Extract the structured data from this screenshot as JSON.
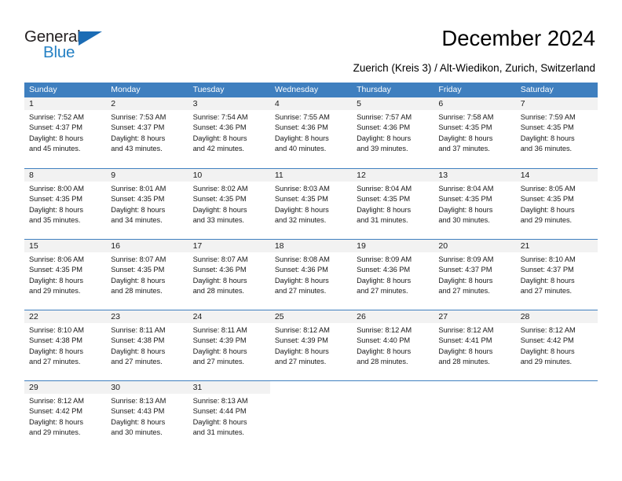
{
  "brand": {
    "name_top": "General",
    "name_bottom": "Blue",
    "triangle_icon": "blue-triangle-icon",
    "color_dark": "#231f20",
    "color_blue": "#2581c4"
  },
  "header": {
    "title": "December 2024",
    "subtitle": "Zuerich (Kreis 3) / Alt-Wiedikon, Zurich, Switzerland"
  },
  "theme": {
    "header_blue": "#3f7fbf",
    "daynum_band": "#f2f2f2",
    "text": "#1a1a1a"
  },
  "weekdays": [
    "Sunday",
    "Monday",
    "Tuesday",
    "Wednesday",
    "Thursday",
    "Friday",
    "Saturday"
  ],
  "weeks": [
    [
      {
        "day": "1",
        "sunrise": "Sunrise: 7:52 AM",
        "sunset": "Sunset: 4:37 PM",
        "daylight1": "Daylight: 8 hours",
        "daylight2": "and 45 minutes."
      },
      {
        "day": "2",
        "sunrise": "Sunrise: 7:53 AM",
        "sunset": "Sunset: 4:37 PM",
        "daylight1": "Daylight: 8 hours",
        "daylight2": "and 43 minutes."
      },
      {
        "day": "3",
        "sunrise": "Sunrise: 7:54 AM",
        "sunset": "Sunset: 4:36 PM",
        "daylight1": "Daylight: 8 hours",
        "daylight2": "and 42 minutes."
      },
      {
        "day": "4",
        "sunrise": "Sunrise: 7:55 AM",
        "sunset": "Sunset: 4:36 PM",
        "daylight1": "Daylight: 8 hours",
        "daylight2": "and 40 minutes."
      },
      {
        "day": "5",
        "sunrise": "Sunrise: 7:57 AM",
        "sunset": "Sunset: 4:36 PM",
        "daylight1": "Daylight: 8 hours",
        "daylight2": "and 39 minutes."
      },
      {
        "day": "6",
        "sunrise": "Sunrise: 7:58 AM",
        "sunset": "Sunset: 4:35 PM",
        "daylight1": "Daylight: 8 hours",
        "daylight2": "and 37 minutes."
      },
      {
        "day": "7",
        "sunrise": "Sunrise: 7:59 AM",
        "sunset": "Sunset: 4:35 PM",
        "daylight1": "Daylight: 8 hours",
        "daylight2": "and 36 minutes."
      }
    ],
    [
      {
        "day": "8",
        "sunrise": "Sunrise: 8:00 AM",
        "sunset": "Sunset: 4:35 PM",
        "daylight1": "Daylight: 8 hours",
        "daylight2": "and 35 minutes."
      },
      {
        "day": "9",
        "sunrise": "Sunrise: 8:01 AM",
        "sunset": "Sunset: 4:35 PM",
        "daylight1": "Daylight: 8 hours",
        "daylight2": "and 34 minutes."
      },
      {
        "day": "10",
        "sunrise": "Sunrise: 8:02 AM",
        "sunset": "Sunset: 4:35 PM",
        "daylight1": "Daylight: 8 hours",
        "daylight2": "and 33 minutes."
      },
      {
        "day": "11",
        "sunrise": "Sunrise: 8:03 AM",
        "sunset": "Sunset: 4:35 PM",
        "daylight1": "Daylight: 8 hours",
        "daylight2": "and 32 minutes."
      },
      {
        "day": "12",
        "sunrise": "Sunrise: 8:04 AM",
        "sunset": "Sunset: 4:35 PM",
        "daylight1": "Daylight: 8 hours",
        "daylight2": "and 31 minutes."
      },
      {
        "day": "13",
        "sunrise": "Sunrise: 8:04 AM",
        "sunset": "Sunset: 4:35 PM",
        "daylight1": "Daylight: 8 hours",
        "daylight2": "and 30 minutes."
      },
      {
        "day": "14",
        "sunrise": "Sunrise: 8:05 AM",
        "sunset": "Sunset: 4:35 PM",
        "daylight1": "Daylight: 8 hours",
        "daylight2": "and 29 minutes."
      }
    ],
    [
      {
        "day": "15",
        "sunrise": "Sunrise: 8:06 AM",
        "sunset": "Sunset: 4:35 PM",
        "daylight1": "Daylight: 8 hours",
        "daylight2": "and 29 minutes."
      },
      {
        "day": "16",
        "sunrise": "Sunrise: 8:07 AM",
        "sunset": "Sunset: 4:35 PM",
        "daylight1": "Daylight: 8 hours",
        "daylight2": "and 28 minutes."
      },
      {
        "day": "17",
        "sunrise": "Sunrise: 8:07 AM",
        "sunset": "Sunset: 4:36 PM",
        "daylight1": "Daylight: 8 hours",
        "daylight2": "and 28 minutes."
      },
      {
        "day": "18",
        "sunrise": "Sunrise: 8:08 AM",
        "sunset": "Sunset: 4:36 PM",
        "daylight1": "Daylight: 8 hours",
        "daylight2": "and 27 minutes."
      },
      {
        "day": "19",
        "sunrise": "Sunrise: 8:09 AM",
        "sunset": "Sunset: 4:36 PM",
        "daylight1": "Daylight: 8 hours",
        "daylight2": "and 27 minutes."
      },
      {
        "day": "20",
        "sunrise": "Sunrise: 8:09 AM",
        "sunset": "Sunset: 4:37 PM",
        "daylight1": "Daylight: 8 hours",
        "daylight2": "and 27 minutes."
      },
      {
        "day": "21",
        "sunrise": "Sunrise: 8:10 AM",
        "sunset": "Sunset: 4:37 PM",
        "daylight1": "Daylight: 8 hours",
        "daylight2": "and 27 minutes."
      }
    ],
    [
      {
        "day": "22",
        "sunrise": "Sunrise: 8:10 AM",
        "sunset": "Sunset: 4:38 PM",
        "daylight1": "Daylight: 8 hours",
        "daylight2": "and 27 minutes."
      },
      {
        "day": "23",
        "sunrise": "Sunrise: 8:11 AM",
        "sunset": "Sunset: 4:38 PM",
        "daylight1": "Daylight: 8 hours",
        "daylight2": "and 27 minutes."
      },
      {
        "day": "24",
        "sunrise": "Sunrise: 8:11 AM",
        "sunset": "Sunset: 4:39 PM",
        "daylight1": "Daylight: 8 hours",
        "daylight2": "and 27 minutes."
      },
      {
        "day": "25",
        "sunrise": "Sunrise: 8:12 AM",
        "sunset": "Sunset: 4:39 PM",
        "daylight1": "Daylight: 8 hours",
        "daylight2": "and 27 minutes."
      },
      {
        "day": "26",
        "sunrise": "Sunrise: 8:12 AM",
        "sunset": "Sunset: 4:40 PM",
        "daylight1": "Daylight: 8 hours",
        "daylight2": "and 28 minutes."
      },
      {
        "day": "27",
        "sunrise": "Sunrise: 8:12 AM",
        "sunset": "Sunset: 4:41 PM",
        "daylight1": "Daylight: 8 hours",
        "daylight2": "and 28 minutes."
      },
      {
        "day": "28",
        "sunrise": "Sunrise: 8:12 AM",
        "sunset": "Sunset: 4:42 PM",
        "daylight1": "Daylight: 8 hours",
        "daylight2": "and 29 minutes."
      }
    ],
    [
      {
        "day": "29",
        "sunrise": "Sunrise: 8:12 AM",
        "sunset": "Sunset: 4:42 PM",
        "daylight1": "Daylight: 8 hours",
        "daylight2": "and 29 minutes."
      },
      {
        "day": "30",
        "sunrise": "Sunrise: 8:13 AM",
        "sunset": "Sunset: 4:43 PM",
        "daylight1": "Daylight: 8 hours",
        "daylight2": "and 30 minutes."
      },
      {
        "day": "31",
        "sunrise": "Sunrise: 8:13 AM",
        "sunset": "Sunset: 4:44 PM",
        "daylight1": "Daylight: 8 hours",
        "daylight2": "and 31 minutes."
      },
      {
        "day": "",
        "sunrise": "",
        "sunset": "",
        "daylight1": "",
        "daylight2": ""
      },
      {
        "day": "",
        "sunrise": "",
        "sunset": "",
        "daylight1": "",
        "daylight2": ""
      },
      {
        "day": "",
        "sunrise": "",
        "sunset": "",
        "daylight1": "",
        "daylight2": ""
      },
      {
        "day": "",
        "sunrise": "",
        "sunset": "",
        "daylight1": "",
        "daylight2": ""
      }
    ]
  ]
}
